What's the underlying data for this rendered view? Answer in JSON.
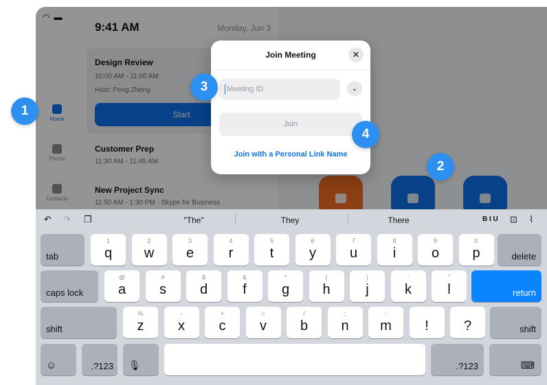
{
  "sidebar": {
    "items": [
      {
        "label": "Home",
        "icon": "home-icon"
      },
      {
        "label": "Phone",
        "icon": "phone-icon"
      },
      {
        "label": "Contacts",
        "icon": "contacts-icon"
      }
    ]
  },
  "home": {
    "time": "9:41 AM",
    "date": "Monday, Jun 3",
    "meetings": [
      {
        "title": "Design Review",
        "time": "10:00 AM - 11:00 AM",
        "host": "Host: Peng Zheng",
        "action": "Start"
      },
      {
        "title": "Customer Prep",
        "time": "11:30 AM - 11:45 AM"
      },
      {
        "title": "New Project Sync",
        "time": "11:50 AM - 1:30 PM · Skype for Business"
      }
    ],
    "tile_colors": {
      "video": "#f26d21",
      "join": "#0e71eb",
      "share": "#0e71eb"
    }
  },
  "dialog": {
    "title": "Join Meeting",
    "close_icon": "close-icon",
    "meeting_id_placeholder": "Meeting ID",
    "join_label": "Join",
    "personal_link_label": "Join with a Personal Link Name"
  },
  "callouts": [
    "1",
    "2",
    "3",
    "4"
  ],
  "keyboard": {
    "suggestions": [
      "\"The\"",
      "They",
      "There"
    ],
    "format_label": "B I U",
    "row1": [
      {
        "main": "q",
        "top": "1"
      },
      {
        "main": "w",
        "top": "2"
      },
      {
        "main": "e",
        "top": "3"
      },
      {
        "main": "r",
        "top": "4"
      },
      {
        "main": "t",
        "top": "5"
      },
      {
        "main": "y",
        "top": "6"
      },
      {
        "main": "u",
        "top": "7"
      },
      {
        "main": "i",
        "top": "8"
      },
      {
        "main": "o",
        "top": "9"
      },
      {
        "main": "p",
        "top": "0"
      }
    ],
    "row2": [
      {
        "main": "a",
        "top": "@"
      },
      {
        "main": "s",
        "top": "#"
      },
      {
        "main": "d",
        "top": "$"
      },
      {
        "main": "f",
        "top": "&"
      },
      {
        "main": "g",
        "top": "*"
      },
      {
        "main": "h",
        "top": "("
      },
      {
        "main": "j",
        "top": ")"
      },
      {
        "main": "k",
        "top": "’"
      },
      {
        "main": "l",
        "top": "”"
      }
    ],
    "row3": [
      {
        "main": "z",
        "top": "%"
      },
      {
        "main": "x",
        "top": "-"
      },
      {
        "main": "c",
        "top": "+"
      },
      {
        "main": "v",
        "top": "="
      },
      {
        "main": "b",
        "top": "/"
      },
      {
        "main": "n",
        "top": ";"
      },
      {
        "main": "m",
        "top": ":"
      },
      {
        "main": "!",
        "top": ""
      },
      {
        "main": "?",
        "top": ""
      }
    ],
    "tab": "tab",
    "delete": "delete",
    "caps_lock": "caps lock",
    "return": "return",
    "shift": "shift",
    "numbers": ".?123"
  }
}
